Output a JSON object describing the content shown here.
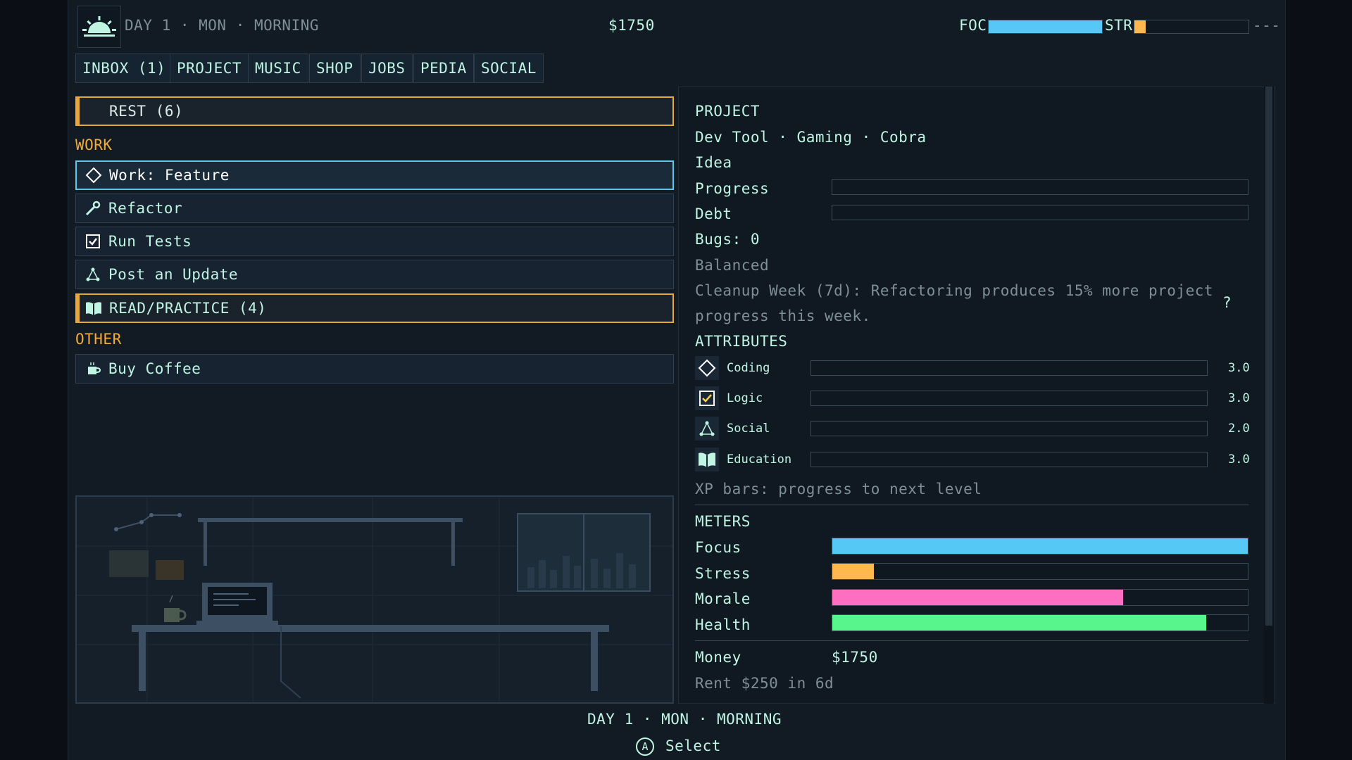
{
  "header": {
    "day_text": "DAY 1 · MON · MORNING",
    "money": "$1750",
    "foc_label": "FOC",
    "str_label": "STR",
    "trailing": "---",
    "focus_level": 1.0,
    "stress_level": 0.1
  },
  "tabs": [
    "INBOX (1)",
    "PROJECT",
    "MUSIC",
    "SHOP",
    "JOBS",
    "PEDIA",
    "SOCIAL"
  ],
  "actions": {
    "rest": "REST (6)",
    "work_header": "WORK",
    "work_items": [
      "Work: Feature",
      "Refactor",
      "Run Tests",
      "Post an Update"
    ],
    "read": "READ/PRACTICE (4)",
    "other_header": "OTHER",
    "other_items": [
      "Buy Coffee"
    ]
  },
  "project": {
    "header": "PROJECT",
    "subtitle": "Dev Tool · Gaming · Cobra",
    "stage": "Idea",
    "progress_label": "Progress",
    "debt_label": "Debt",
    "bugs": "Bugs: 0",
    "balance": "Balanced",
    "event_line1": "Cleanup Week (7d): Refactoring produces 15% more project",
    "event_line2": "progress this week.",
    "help": "?"
  },
  "attributes": {
    "header": "ATTRIBUTES",
    "items": [
      {
        "name": "Coding",
        "value": "3.0",
        "icon": "code-icon"
      },
      {
        "name": "Logic",
        "value": "3.0",
        "icon": "checkbox-icon"
      },
      {
        "name": "Social",
        "value": "2.0",
        "icon": "social-icon"
      },
      {
        "name": "Education",
        "value": "3.0",
        "icon": "book-icon"
      }
    ],
    "note": "XP bars: progress to next level"
  },
  "meters": {
    "header": "METERS",
    "items": [
      {
        "name": "Focus",
        "level": 1.0,
        "color": "#56c8f5"
      },
      {
        "name": "Stress",
        "level": 0.1,
        "color": "#ffb84d"
      },
      {
        "name": "Morale",
        "level": 0.7,
        "color": "#ff6fc1"
      },
      {
        "name": "Health",
        "level": 0.9,
        "color": "#58f58c"
      }
    ]
  },
  "finance": {
    "money_label": "Money",
    "money_value": "$1750",
    "rent": "Rent $250 in 6d"
  },
  "footer": {
    "day_text": "DAY 1 · MON · MORNING",
    "select_label": "Select",
    "button_glyph": "A"
  }
}
